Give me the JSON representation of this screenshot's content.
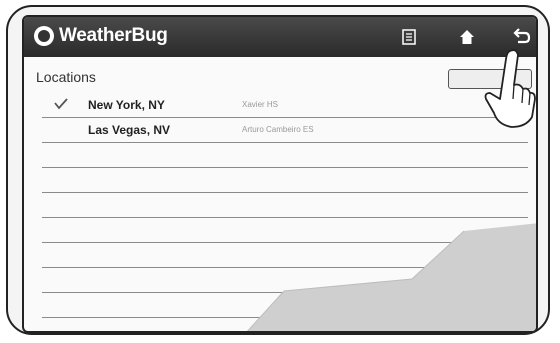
{
  "app": {
    "name": "WeatherBug",
    "logo_icon": "weatherbug-logo-icon"
  },
  "toolbar": {
    "menu_icon": "menu-icon",
    "home_icon": "home-icon",
    "back_icon": "back-arrow-icon"
  },
  "locations": {
    "title": "Locations",
    "items": [
      {
        "city": "New York, NY",
        "station": "Xavier HS",
        "checked": true
      },
      {
        "city": "Las Vegas, NV",
        "station": "Arturo Cambeiro ES",
        "checked": false
      }
    ]
  }
}
